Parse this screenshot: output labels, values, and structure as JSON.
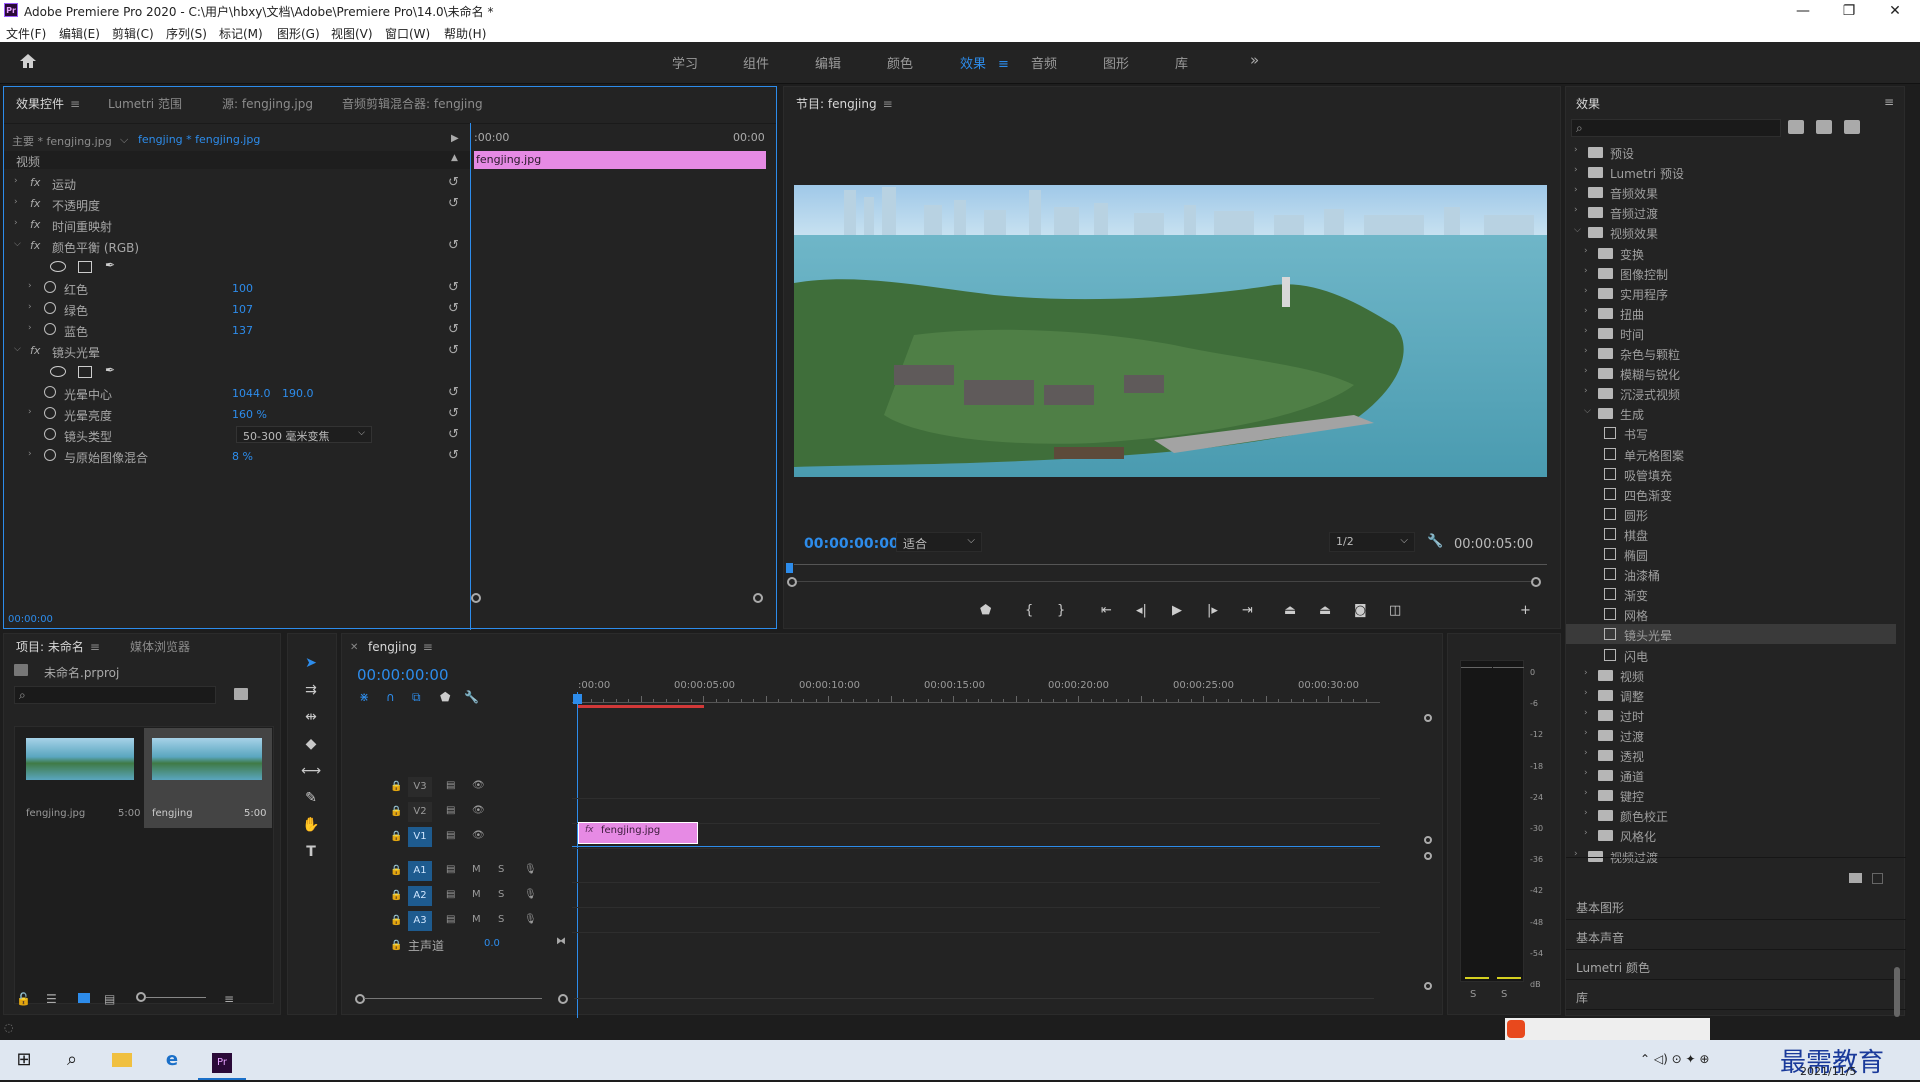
{
  "window": {
    "title": "Adobe Premiere Pro 2020 - C:\\用户\\hbxy\\文档\\Adobe\\Premiere Pro\\14.0\\未命名 *",
    "app_icon": "Pr",
    "minimize": "—",
    "restore": "❐",
    "close": "✕"
  },
  "menu": [
    "文件(F)",
    "编辑(E)",
    "剪辑(C)",
    "序列(S)",
    "标记(M)",
    "图形(G)",
    "视图(V)",
    "窗口(W)",
    "帮助(H)"
  ],
  "workspaces": [
    "学习",
    "组件",
    "编辑",
    "颜色",
    "效果",
    "音频",
    "图形",
    "库"
  ],
  "active_workspace": "效果",
  "effect_controls": {
    "tabs": [
      "效果控件",
      "Lumetri 范围",
      "源: fengjing.jpg",
      "音频剪辑混合器: fengjing"
    ],
    "master": "主要 * fengjing.jpg",
    "clip": "fengjing * fengjing.jpg",
    "tl_start": ":00:00",
    "tl_end": "00:00",
    "clip_label": "fengjing.jpg",
    "section": "视频",
    "rows": [
      {
        "name": "运动"
      },
      {
        "name": "不透明度"
      },
      {
        "name": "时间重映射"
      },
      {
        "name": "颜色平衡 (RGB)"
      },
      {
        "name": "红色",
        "value": "100"
      },
      {
        "name": "绿色",
        "value": "107"
      },
      {
        "name": "蓝色",
        "value": "137"
      },
      {
        "name": "镜头光晕"
      },
      {
        "name": "光晕中心",
        "value": "1044.0",
        "value2": "190.0"
      },
      {
        "name": "光晕亮度",
        "value": "160 %"
      },
      {
        "name": "镜头类型",
        "value": "50-300 毫米变焦"
      },
      {
        "name": "与原始图像混合",
        "value": "8 %"
      }
    ],
    "timecode": "00:00:00"
  },
  "program": {
    "tab": "节目: fengjing",
    "timecode": "00:00:00:00",
    "fit": "适合",
    "res": "1/2",
    "duration": "00:00:05:00"
  },
  "effects_panel": {
    "title": "效果",
    "items": [
      {
        "label": "预设",
        "lvl": 0,
        "open": false
      },
      {
        "label": "Lumetri 预设",
        "lvl": 0,
        "open": false
      },
      {
        "label": "音频效果",
        "lvl": 0,
        "open": false
      },
      {
        "label": "音频过渡",
        "lvl": 0,
        "open": false
      },
      {
        "label": "视频效果",
        "lvl": 0,
        "open": true
      },
      {
        "label": "变换",
        "lvl": 1,
        "open": false
      },
      {
        "label": "图像控制",
        "lvl": 1,
        "open": false
      },
      {
        "label": "实用程序",
        "lvl": 1,
        "open": false
      },
      {
        "label": "扭曲",
        "lvl": 1,
        "open": false
      },
      {
        "label": "时间",
        "lvl": 1,
        "open": false
      },
      {
        "label": "杂色与颗粒",
        "lvl": 1,
        "open": false
      },
      {
        "label": "模糊与锐化",
        "lvl": 1,
        "open": false
      },
      {
        "label": "沉浸式视频",
        "lvl": 1,
        "open": false
      },
      {
        "label": "生成",
        "lvl": 1,
        "open": true
      },
      {
        "label": "书写",
        "lvl": 2
      },
      {
        "label": "单元格图案",
        "lvl": 2
      },
      {
        "label": "吸管填充",
        "lvl": 2
      },
      {
        "label": "四色渐变",
        "lvl": 2
      },
      {
        "label": "圆形",
        "lvl": 2
      },
      {
        "label": "棋盘",
        "lvl": 2
      },
      {
        "label": "椭圆",
        "lvl": 2
      },
      {
        "label": "油漆桶",
        "lvl": 2
      },
      {
        "label": "渐变",
        "lvl": 2
      },
      {
        "label": "网格",
        "lvl": 2
      },
      {
        "label": "镜头光晕",
        "lvl": 2,
        "selected": true
      },
      {
        "label": "闪电",
        "lvl": 2
      },
      {
        "label": "视频",
        "lvl": 1,
        "open": false
      },
      {
        "label": "调整",
        "lvl": 1,
        "open": false
      },
      {
        "label": "过时",
        "lvl": 1,
        "open": false
      },
      {
        "label": "过渡",
        "lvl": 1,
        "open": false
      },
      {
        "label": "透视",
        "lvl": 1,
        "open": false
      },
      {
        "label": "通道",
        "lvl": 1,
        "open": false
      },
      {
        "label": "键控",
        "lvl": 1,
        "open": false
      },
      {
        "label": "颜色校正",
        "lvl": 1,
        "open": false
      },
      {
        "label": "风格化",
        "lvl": 1,
        "open": false
      },
      {
        "label": "视频过渡",
        "lvl": 0,
        "open": false
      }
    ],
    "sections": [
      "基本图形",
      "基本声音",
      "Lumetri 颜色",
      "库"
    ]
  },
  "project": {
    "tabs": [
      "项目: 未命名",
      "媒体浏览器"
    ],
    "file": "未命名.prproj",
    "items": [
      {
        "name": "fengjing.jpg",
        "dur": "5:00"
      },
      {
        "name": "fengjing",
        "dur": "5:00"
      }
    ]
  },
  "timeline": {
    "tab": "fengjing",
    "timecode": "00:00:00:00",
    "ruler": [
      ":00:00",
      "00:00:05:00",
      "00:00:10:00",
      "00:00:15:00",
      "00:00:20:00",
      "00:00:25:00",
      "00:00:30:00"
    ],
    "video_tracks": [
      "V3",
      "V2",
      "V1"
    ],
    "audio_tracks": [
      "A1",
      "A2",
      "A3"
    ],
    "master": "主声道",
    "master_val": "0.0",
    "clip": "fengjing.jpg",
    "m": "M",
    "s": "S"
  },
  "meter": {
    "ticks": [
      "0",
      "-6",
      "-12",
      "-18",
      "-24",
      "-30",
      "-36",
      "-42",
      "-48",
      "-54",
      "dB"
    ],
    "solo": [
      "S",
      "S"
    ]
  },
  "taskbar": {
    "date": "2021/11/5",
    "watermark": "最需教育"
  },
  "colors": {
    "accent": "#2d8ceb",
    "clip": "#e68ae4",
    "panel": "#232323"
  }
}
